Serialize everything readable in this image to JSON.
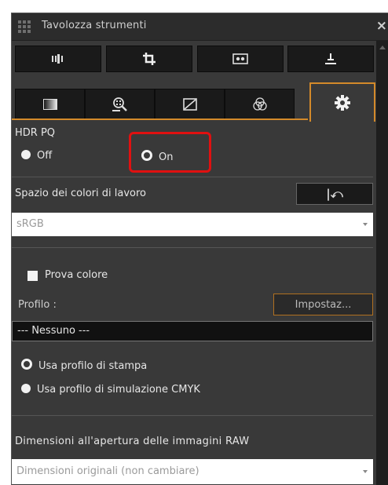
{
  "window": {
    "title": "Tavolozza strumenti",
    "close_glyph": "×"
  },
  "toolbar_row1": [
    {
      "icon": "histogram-icon"
    },
    {
      "icon": "crop-icon"
    },
    {
      "icon": "image-view-icon"
    },
    {
      "icon": "straighten-icon"
    }
  ],
  "toolbar_row2": [
    {
      "icon": "tone-gradient-icon"
    },
    {
      "icon": "noise-reduction-icon"
    },
    {
      "icon": "tone-curve-icon"
    },
    {
      "icon": "color-adjust-icon"
    },
    {
      "icon": "gear-icon",
      "active": true
    }
  ],
  "hdr": {
    "label": "HDR PQ",
    "off_label": "Off",
    "on_label": "On",
    "selected": "On"
  },
  "workspace": {
    "label": "Spazio dei colori di lavoro",
    "reset_glyph": "|⤺",
    "select_value": "sRGB"
  },
  "soft_proof": {
    "checkbox_label": "Prova colore",
    "profile_label": "Profilo :",
    "settings_button": "Impostaz...",
    "profile_value": "--- Nessuno ---",
    "options": [
      "Usa profilo di stampa",
      "Usa profilo di simulazione CMYK"
    ],
    "selected_option": 0
  },
  "raw_open": {
    "label": "Dimensioni all'apertura delle immagini RAW",
    "select_value": "Dimensioni originali (non cambiare)"
  },
  "colors": {
    "accent": "#d48a2a",
    "highlight": "#e01010",
    "panel_bg": "#393939"
  }
}
